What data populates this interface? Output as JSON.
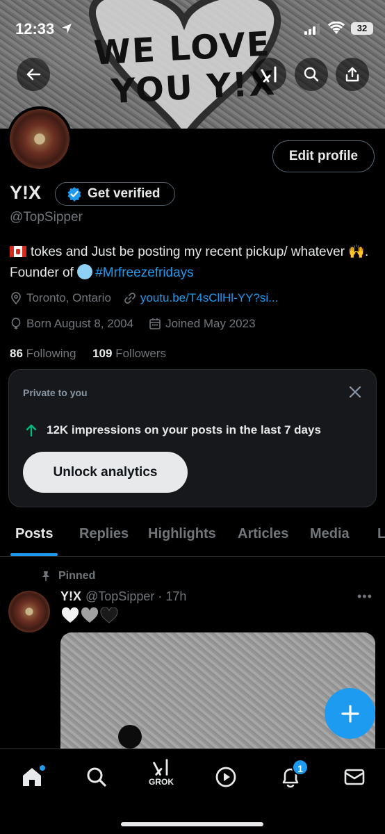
{
  "status_bar": {
    "time": "12:33",
    "battery": "32"
  },
  "banner": {
    "line1": "WE LOVE",
    "line2": "YOU Y!X"
  },
  "profile": {
    "edit_label": "Edit profile",
    "name": "Y!X",
    "verify_label": "Get verified",
    "handle": "@TopSipper",
    "bio_part1": "tokes and Just be posting my recent pickup/ whatever",
    "bio_part2": ". Founder of",
    "bio_hashtag": "#Mrfreezefridays",
    "location": "Toronto, Ontario",
    "link": "youtu.be/T4sCllHl-YY?si...",
    "birthday": "Born August 8, 2004",
    "joined": "Joined May 2023",
    "following_count": "86",
    "following_label": "Following",
    "followers_count": "109",
    "followers_label": "Followers"
  },
  "private_card": {
    "title": "Private to you",
    "stat": "12K impressions on your posts in the last 7 days",
    "button": "Unlock analytics"
  },
  "tabs": [
    {
      "label": "Posts",
      "active": true
    },
    {
      "label": "Replies"
    },
    {
      "label": "Highlights"
    },
    {
      "label": "Articles"
    },
    {
      "label": "Media"
    },
    {
      "label": "L"
    }
  ],
  "post": {
    "pinned_label": "Pinned",
    "author": "Y!X",
    "meta": "@TopSipper · 17h",
    "more": "•••"
  },
  "nav": {
    "grok_label": "GROK",
    "notifications_badge": "1"
  },
  "colors": {
    "accent": "#1d9bf0",
    "background": "#000000",
    "muted": "#71767b",
    "card": "#16181c",
    "up_arrow": "#00ba7c"
  }
}
